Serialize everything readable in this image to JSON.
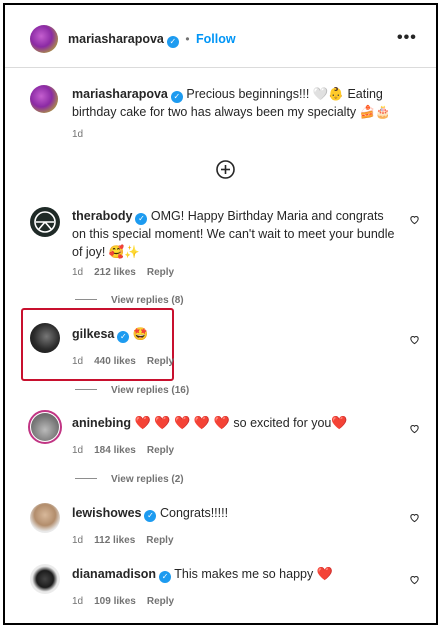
{
  "header": {
    "username": "mariasharapova",
    "separator": "•",
    "follow_label": "Follow",
    "more_icon": "more-horizontal-icon"
  },
  "caption": {
    "username": "mariasharapova",
    "text": "Precious beginnings!!! 🤍👶 Eating birthday cake for two has always been my specialty 🍰🎂",
    "time": "1d"
  },
  "load_more_icon": "plus-circle-icon",
  "comments": [
    {
      "username": "therabody",
      "text": "OMG! Happy Birthday Maria and congrats on this special moment! We can't wait to meet your bundle of joy! 🥰✨",
      "time": "1d",
      "likes": "212 likes",
      "reply": "Reply",
      "view_replies": "View replies (8)"
    },
    {
      "username": "gilkesa",
      "text": "🤩",
      "time": "1d",
      "likes": "440 likes",
      "reply": "Reply",
      "view_replies": "View replies (16)"
    },
    {
      "username": "aninebing",
      "hearts": "❤️ ❤️ ❤️ ❤️ ❤️",
      "text": "so excited for you",
      "trailing_heart": "❤️",
      "time": "1d",
      "likes": "184 likes",
      "reply": "Reply",
      "view_replies": "View replies (2)"
    },
    {
      "username": "lewishowes",
      "text": "Congrats!!!!!",
      "time": "1d",
      "likes": "112 likes",
      "reply": "Reply"
    },
    {
      "username": "dianamadison",
      "text": "This makes me so happy",
      "trailing_heart": "❤️",
      "time": "1d",
      "likes": "109 likes",
      "reply": "Reply"
    }
  ],
  "colors": {
    "accent": "#0095f6",
    "verified": "#1d9bf0",
    "highlight": "#c8102e",
    "heart": "#e0102b"
  }
}
